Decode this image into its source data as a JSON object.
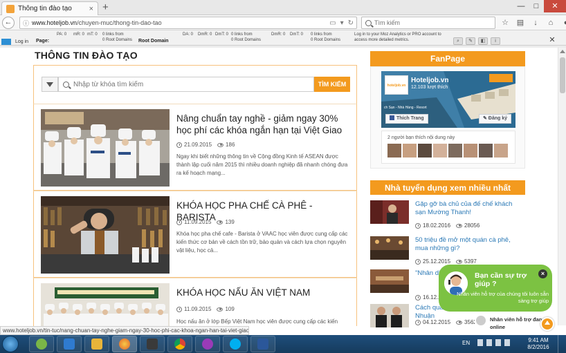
{
  "browser": {
    "tab_title": "Thông tin đào tạo",
    "tab_close": "×",
    "new_tab": "+",
    "window_buttons": [
      "—",
      "□",
      "✕"
    ],
    "url_host": "www.hoteljob.vn",
    "url_path": "/chuyen-muc/thong-tin-dao-tao",
    "search_placeholder": "Tìm kiếm"
  },
  "mozbar": {
    "login": "Log in",
    "page_label": "Page:",
    "root_domain_label": "Root Domain",
    "page_metrics": {
      "pa": "PA: 0",
      "mr": "mR: 0",
      "mt": "mT: 0",
      "links": "0 links from",
      "root_domains": "0 Root Domains"
    },
    "domain_metrics": {
      "da": "DA: 0",
      "dmr": "DmR: 0",
      "dmt": "DmT: 0",
      "links": "0 links from",
      "root_domains": "0 Root Domains"
    },
    "root_metrics": {
      "dmr": "DmR: 0",
      "dmt": "DmT: 0",
      "links": "0 links from",
      "root_domains": "0 Root Domains"
    },
    "message": "Log in to your Moz Analytics or PRO account to access more detailed metrics."
  },
  "page": {
    "section_title": "THÔNG TIN ĐÀO TẠO",
    "search": {
      "placeholder": "Nhập từ khóa tìm kiếm",
      "button": "TÌM KIẾM"
    },
    "articles": [
      {
        "title": "Nâng chuẩn tay nghề - giảm ngay 30% học phí các khóa ngắn hạn tại Việt Giao",
        "date": "21.09.2015",
        "views": "186",
        "excerpt": "Ngay khi biết những thông tin về Cộng đồng Kinh tế ASEAN được thành lập cuối năm 2015 thì nhiều doanh nghiệp đã nhanh chóng đưa ra kế hoạch mạng..."
      },
      {
        "title": "KHÓA HỌC PHA CHẾ CÀ PHÊ - BARISTA",
        "date": "11.09.2015",
        "views": "139",
        "excerpt": "Khóa học pha chế cafe - Barista ở VAAC học viên được cung cấp các kiến thức cơ bản về cách tồn trữ, bảo quản và cách lựa chọn nguyên vật liệu, học cả..."
      },
      {
        "title": "KHÓA HỌC NẤU ĂN VIỆT NAM",
        "date": "11.09.2015",
        "views": "109",
        "excerpt": "Học nấu ăn ở lớp Bếp Việt Nam học viên được cung cấp các kiến"
      }
    ]
  },
  "sidebar": {
    "fanpage_header": "FanPage",
    "fanpage": {
      "name": "Hoteljob.vn",
      "likes": "12.103 lượt thích",
      "tagline": "ch Sạn - Nhà Hàng - Resort",
      "like_button": "Thích Trang",
      "signup_button": "Đăng ký",
      "friends_text": "2 người bạn thích nội dung này",
      "logo_text": "hoteljob.vn"
    },
    "recruiters_header": "Nhà tuyển dụng xem nhiều nhất",
    "recruiters": [
      {
        "title": "Gặp gỡ bà chủ của đế chế khách sạn Mường Thanh!",
        "date": "18.02.2016",
        "views": "28056"
      },
      {
        "title": "50 triệu đề mở một quán cà phê, mua những gì?",
        "date": "25.12.2015",
        "views": "5397"
      },
      {
        "title": "\"Nhân di... quả tình...",
        "date": "16.12.2...",
        "views": ""
      },
      {
        "title": "Cách quản lý nhà hàng Nghìn Nhuận",
        "date": "04.12.2015",
        "views": "3562"
      }
    ]
  },
  "chat": {
    "title": "Bạn cần sự trợ giúp ?",
    "subtitle": "Nhân viên hỗ trợ của chúng tôi luôn sẵn sàng trợ giúp",
    "close": "×",
    "status_title": "Nhân viên hỗ trợ đang",
    "status_sub": "online"
  },
  "statusbar_url": "www.hoteljob.vn/tin-tuc/nang-chuan-tay-nghe-giam-ngay-30-hoc-phi-cac-khoa-ngan-han-tai-viet-giao",
  "taskbar": {
    "lang": "EN",
    "time": "9:41 AM",
    "date": "8/2/2016"
  },
  "colors": {
    "accent": "#f39a1e",
    "link": "#2b79b6",
    "chat_green": "#7cc242"
  }
}
